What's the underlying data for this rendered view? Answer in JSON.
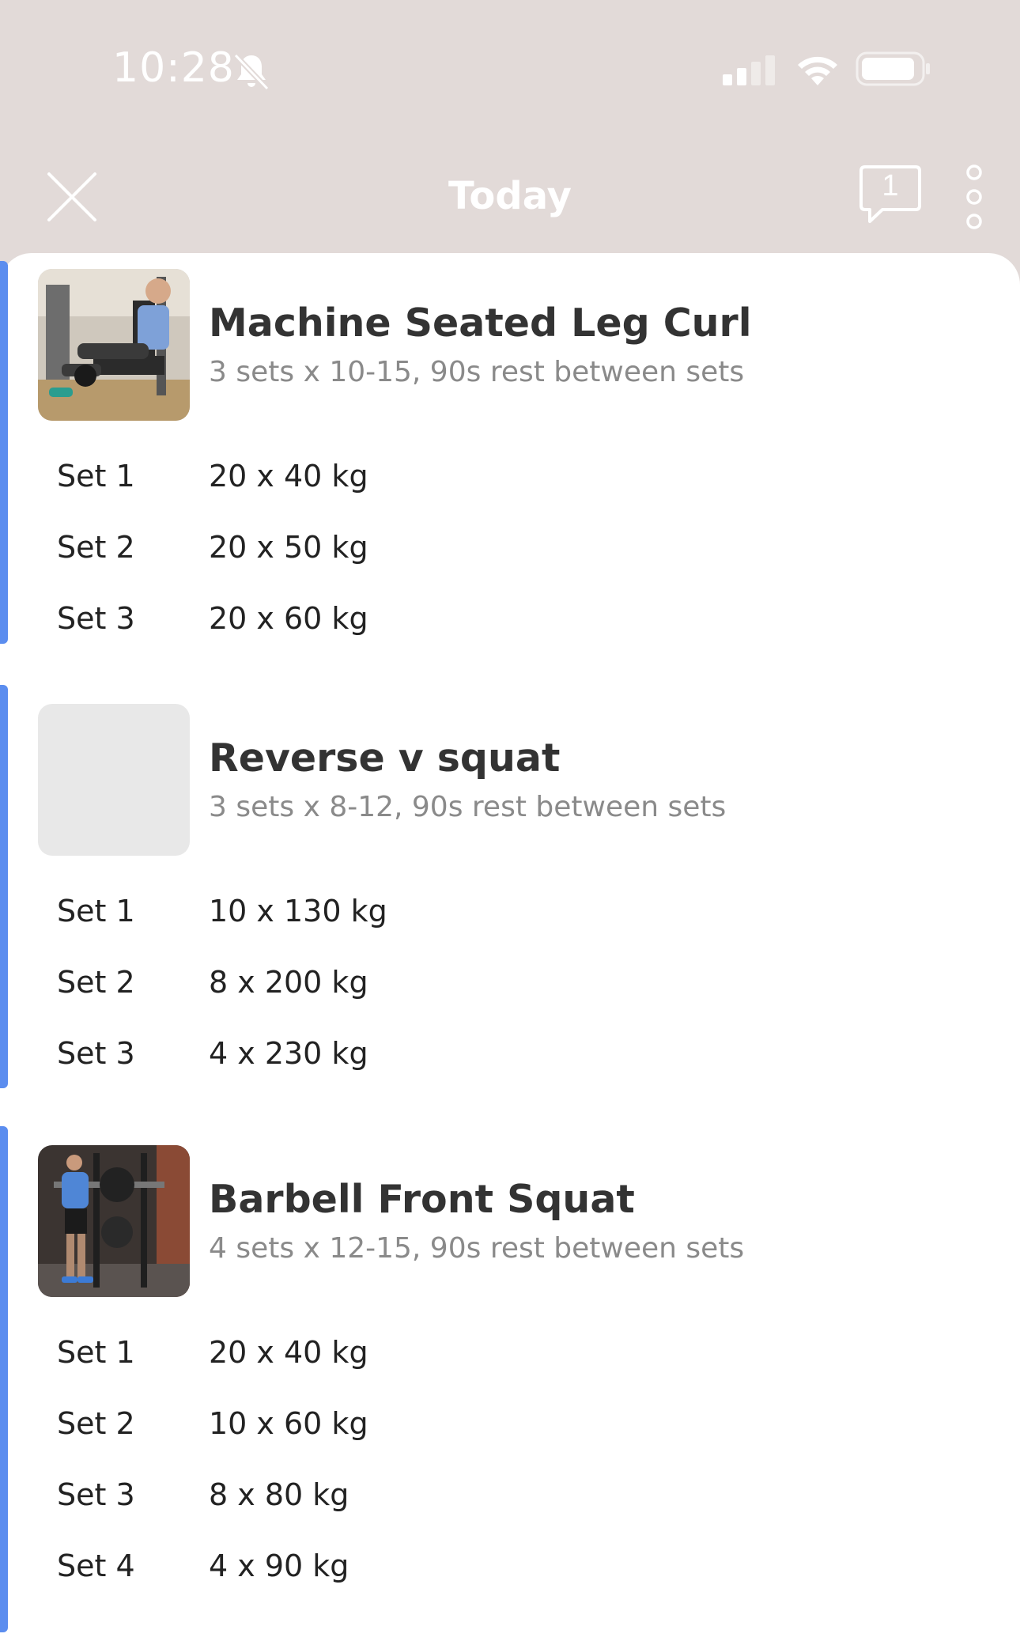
{
  "status_bar": {
    "time": "10:28",
    "icons": [
      "bell-off-icon",
      "signal-icon",
      "wifi-icon",
      "battery-icon"
    ]
  },
  "header": {
    "title": "Today",
    "comment_count": "1",
    "icons": [
      "close-icon",
      "comment-icon",
      "more-vertical-icon"
    ]
  },
  "colors": {
    "header_background": "#e2dad8",
    "accent": "#5b8def",
    "title_text": "#333333",
    "subtitle_text": "#8a8a8a"
  },
  "exercises": [
    {
      "title": "Machine Seated Leg Curl",
      "subtitle": "3 sets x 10-15, 90s rest between sets",
      "sets": [
        {
          "label": "Set 1",
          "value": "20 x 40 kg"
        },
        {
          "label": "Set 2",
          "value": "20 x 50 kg"
        },
        {
          "label": "Set 3",
          "value": "20 x 60 kg"
        }
      ]
    },
    {
      "title": "Reverse v squat",
      "subtitle": "3 sets x 8-12, 90s rest between sets",
      "sets": [
        {
          "label": "Set 1",
          "value": "10 x 130 kg"
        },
        {
          "label": "Set 2",
          "value": "8 x 200 kg"
        },
        {
          "label": "Set 3",
          "value": "4 x 230 kg"
        }
      ]
    },
    {
      "title": "Barbell Front Squat",
      "subtitle": "4 sets x 12-15, 90s rest between sets",
      "sets": [
        {
          "label": "Set 1",
          "value": "20 x 40 kg"
        },
        {
          "label": "Set 2",
          "value": "10 x 60 kg"
        },
        {
          "label": "Set 3",
          "value": "8 x 80 kg"
        },
        {
          "label": "Set 4",
          "value": "4 x 90 kg"
        }
      ]
    }
  ]
}
